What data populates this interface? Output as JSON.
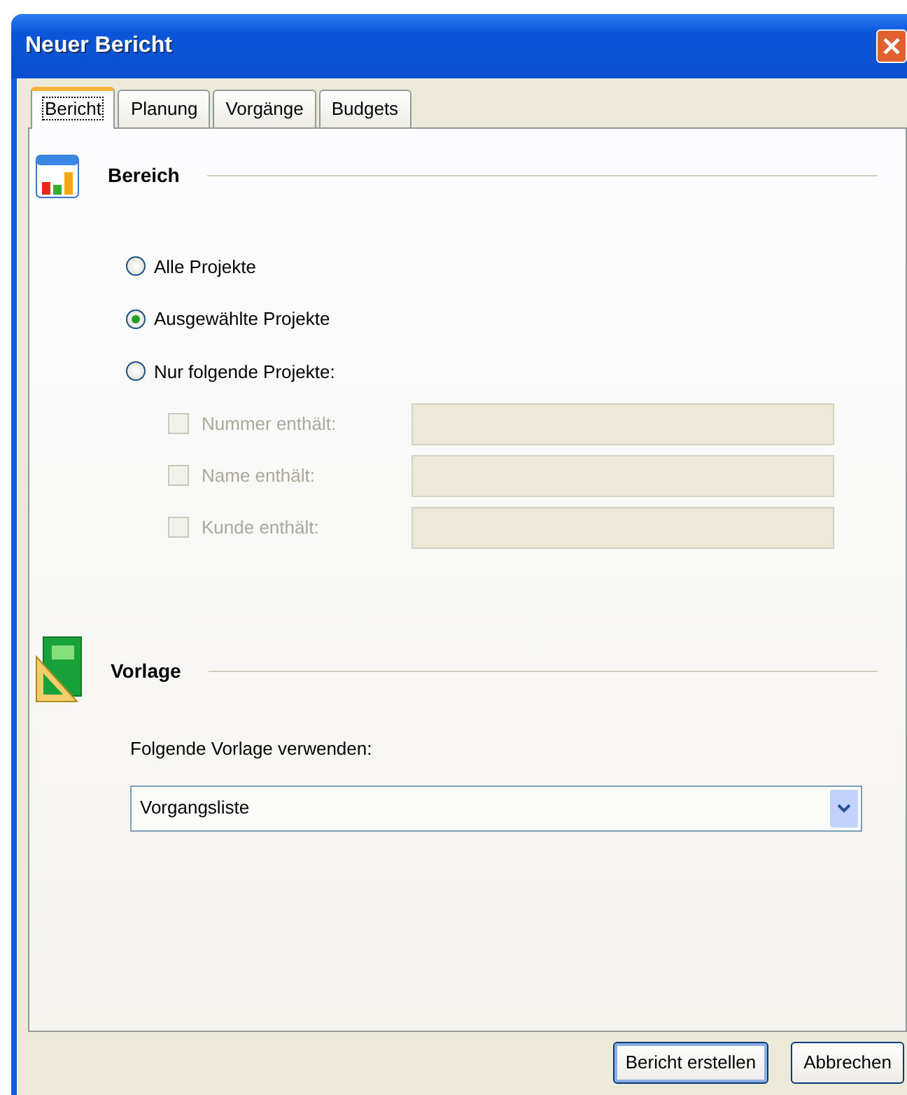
{
  "window": {
    "title": "Neuer Bericht"
  },
  "tabs": [
    {
      "label": "Bericht",
      "selected": true
    },
    {
      "label": "Planung",
      "selected": false
    },
    {
      "label": "Vorgänge",
      "selected": false
    },
    {
      "label": "Budgets",
      "selected": false
    }
  ],
  "scope": {
    "heading": "Bereich",
    "options": [
      {
        "label": "Alle Projekte",
        "selected": false
      },
      {
        "label": "Ausgewählte Projekte",
        "selected": true
      },
      {
        "label": "Nur folgende Projekte:",
        "selected": false
      }
    ],
    "filters": [
      {
        "label": "Nummer enthält:",
        "checked": false,
        "disabled": true
      },
      {
        "label": "Name enthält:",
        "checked": false,
        "disabled": true
      },
      {
        "label": "Kunde enthält:",
        "checked": false,
        "disabled": true
      }
    ]
  },
  "template": {
    "heading": "Vorlage",
    "label": "Folgende Vorlage verwenden:",
    "value": "Vorgangsliste"
  },
  "buttons": [
    {
      "label": "Bericht erstellen",
      "default": true
    },
    {
      "label": "Abbrechen",
      "default": false
    }
  ]
}
